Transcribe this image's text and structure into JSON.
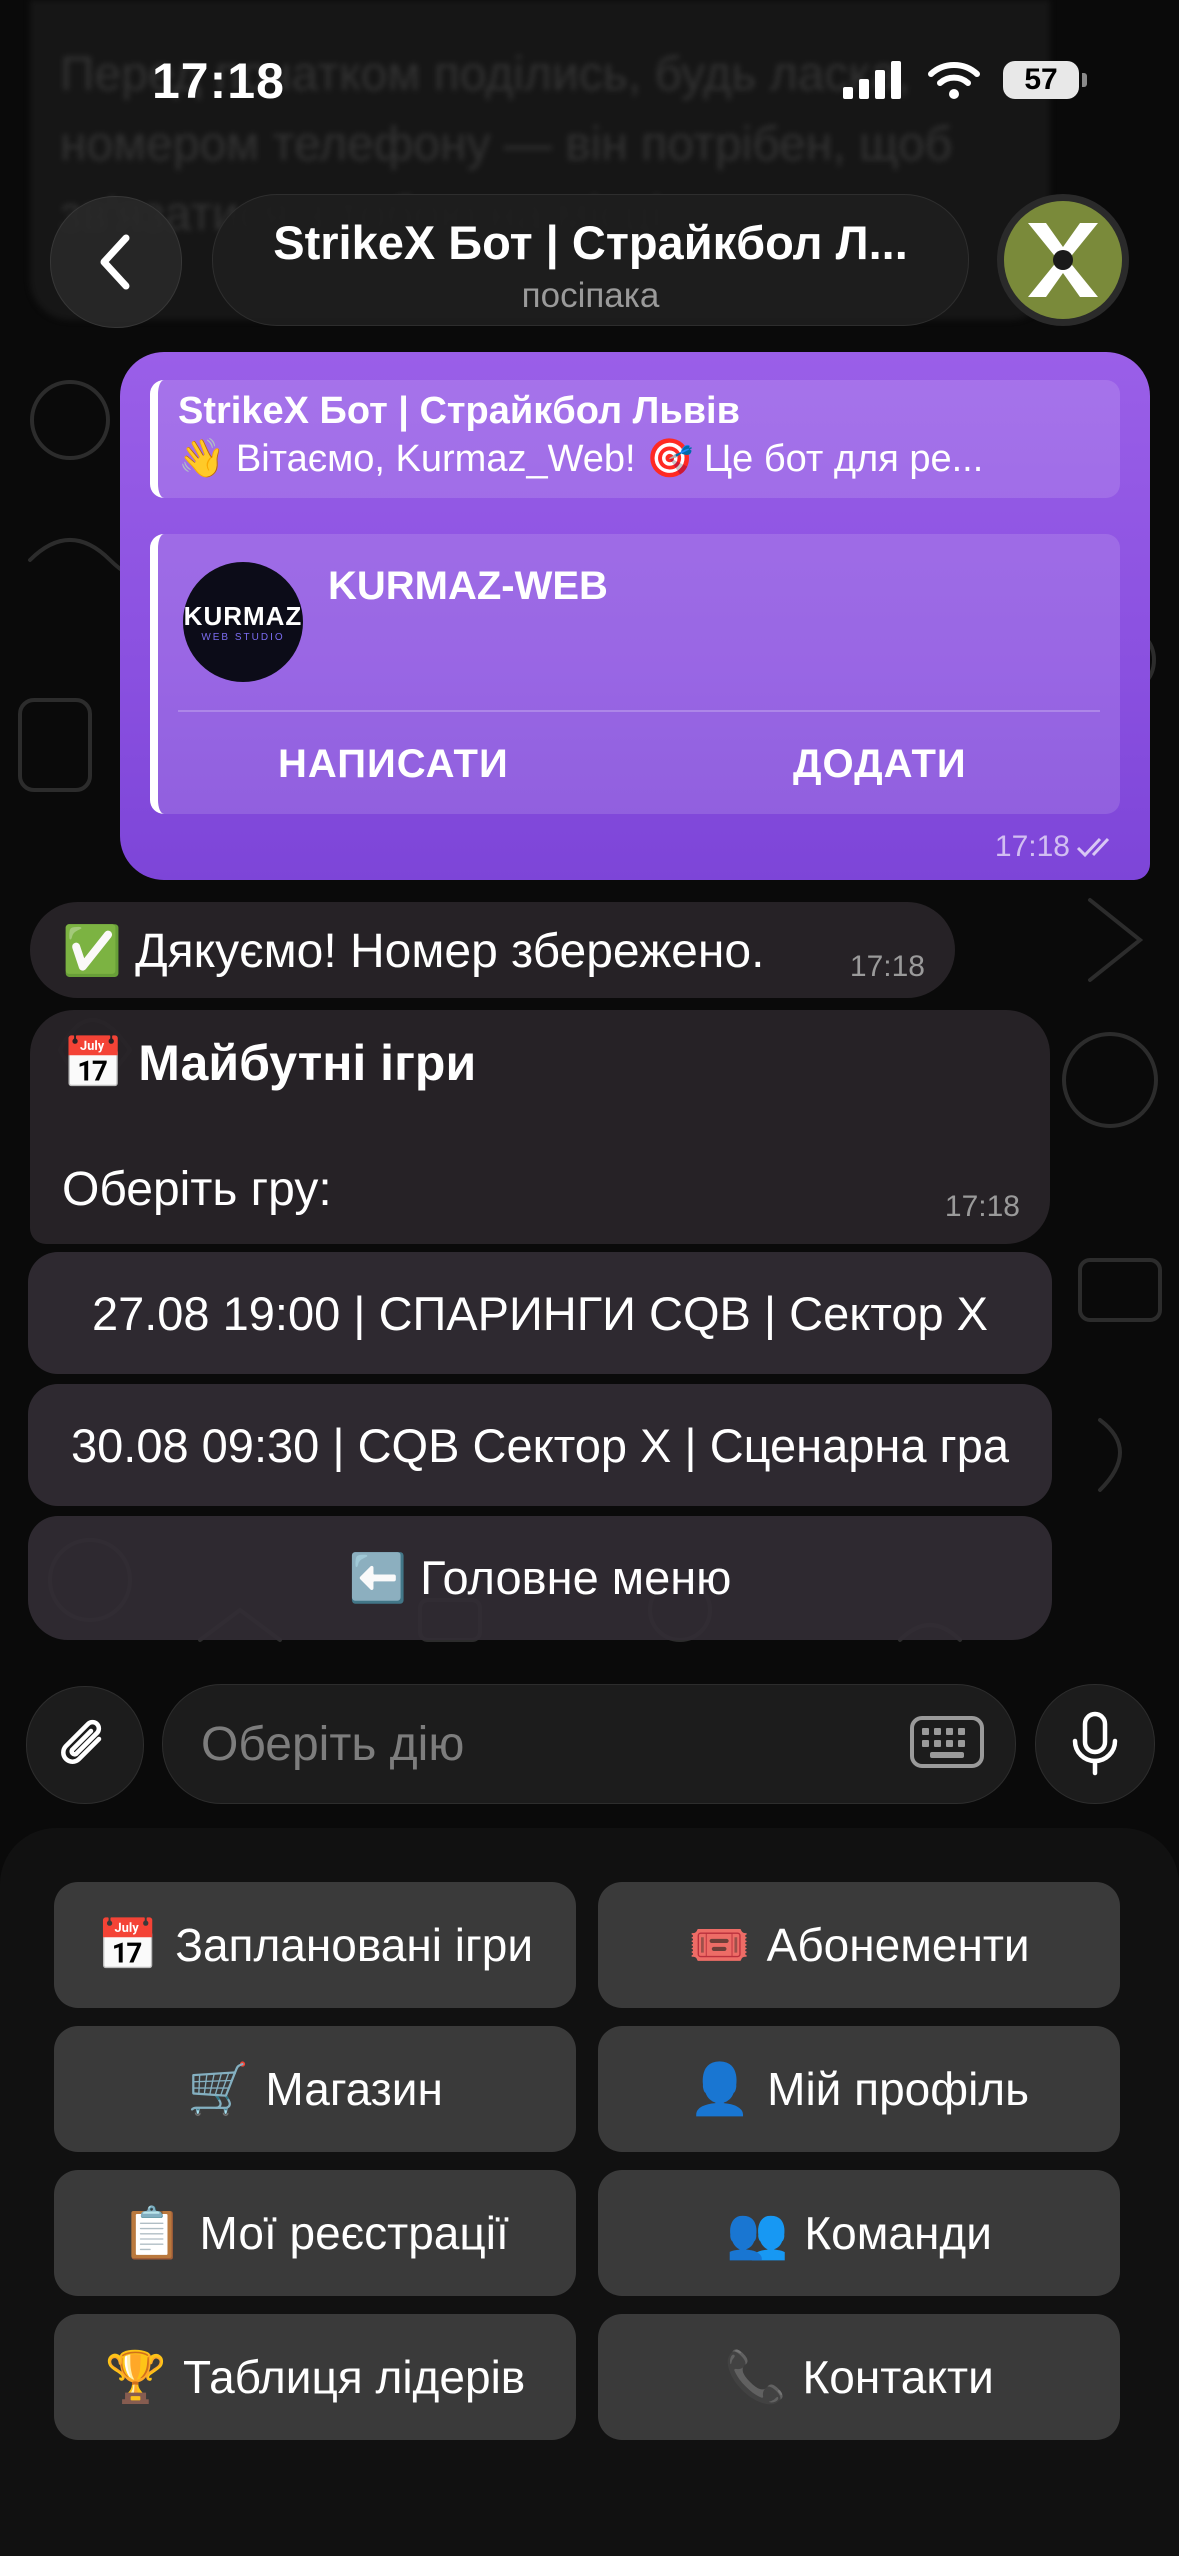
{
  "status_bar": {
    "time": "17:18",
    "battery": "57"
  },
  "background_message": {
    "lines": [
      "Перед початком поділись, будь ласка,",
      "номером телефону — він потрібен, щоб",
      "зв'язатися з тобою на місці"
    ]
  },
  "header": {
    "title": "StrikeX Бот | Страйкбол Л...",
    "subtitle": "посіпака"
  },
  "outgoing": {
    "reply_title": "StrikeX Бот | Страйкбол Львів",
    "reply_text": "👋 Вітаємо, Kurmaz_Web! 🎯 Це бот для ре...",
    "contact_logo_main": "KURMAZ",
    "contact_logo_sub": "WEB STUDIO",
    "contact_name": "KURMAZ-WEB",
    "btn_write": "НАПИСАТИ",
    "btn_add": "ДОДАТИ",
    "time": "17:18"
  },
  "thanks_message": {
    "icon": "✅",
    "text": "Дякуємо! Номер збережено.",
    "time": "17:18"
  },
  "games_message": {
    "icon": "📅",
    "title": "Майбутні ігри",
    "prompt": "Оберіть гру:",
    "time": "17:18"
  },
  "inline_buttons": [
    "27.08 19:00 | СПАРИНГИ CQB | Сектор X",
    "30.08 09:30 | CQB Сектор X | Сценарна гра",
    "⬅️ Головне меню"
  ],
  "input": {
    "placeholder": "Оберіть дію"
  },
  "reply_keyboard": [
    {
      "icon": "📅",
      "label": "Заплановані ігри"
    },
    {
      "icon": "🎟️",
      "label": "Абонементи"
    },
    {
      "icon": "🛒",
      "label": "Магазин"
    },
    {
      "icon": "👤",
      "label": "Мій профіль"
    },
    {
      "icon": "📋",
      "label": "Мої реєстрації"
    },
    {
      "icon": "👥",
      "label": "Команди"
    },
    {
      "icon": "🏆",
      "label": "Таблиця лідерів"
    },
    {
      "icon": "📞",
      "label": "Контакти"
    }
  ],
  "colors": {
    "accent_purple": "#8a50e0",
    "bubble_in": "#282428",
    "keyboard_btn": "#3a3a3a"
  }
}
